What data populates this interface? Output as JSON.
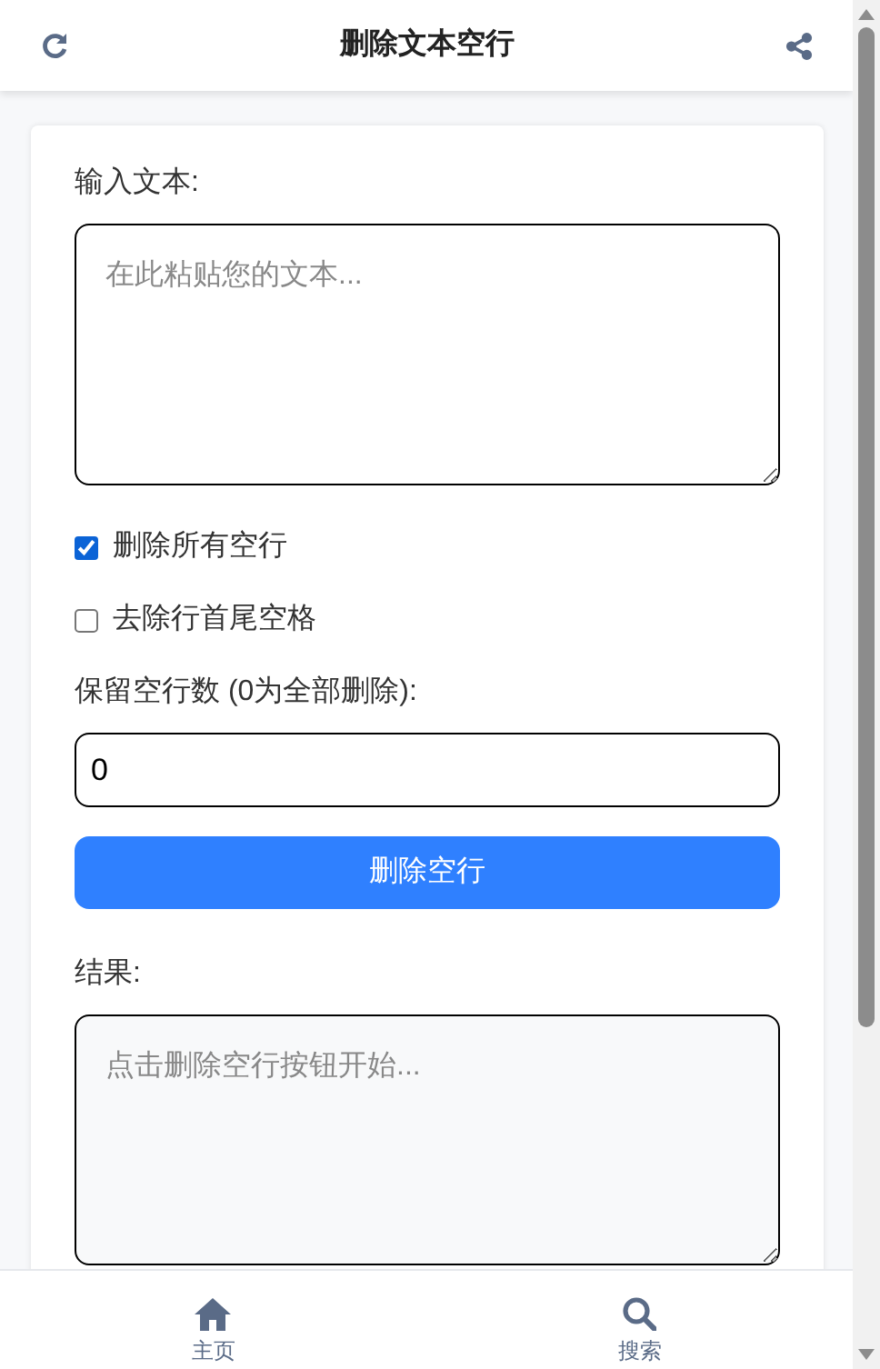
{
  "header": {
    "title": "删除文本空行"
  },
  "input": {
    "label": "输入文本:",
    "placeholder": "在此粘贴您的文本..."
  },
  "options": [
    {
      "label": "删除所有空行",
      "checked": true
    },
    {
      "label": "去除行首尾空格",
      "checked": false
    }
  ],
  "keep": {
    "label": "保留空行数 (0为全部删除):",
    "value": "0"
  },
  "action": {
    "label": "删除空行"
  },
  "result": {
    "label": "结果:",
    "placeholder": "点击删除空行按钮开始..."
  },
  "bottom_nav": [
    {
      "kind": "home",
      "label": "主页"
    },
    {
      "kind": "search",
      "label": "搜索"
    }
  ]
}
